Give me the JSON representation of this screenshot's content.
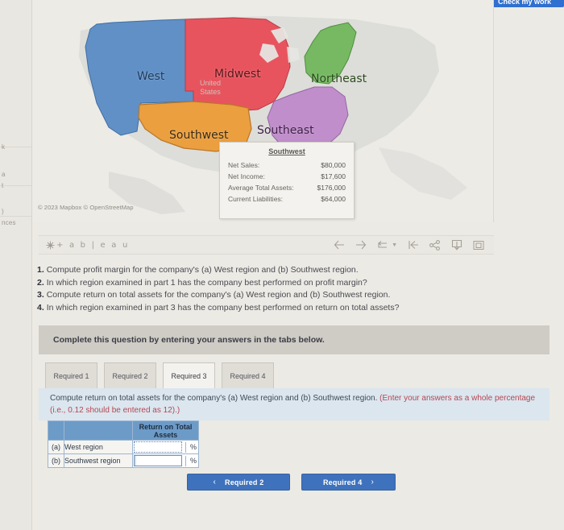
{
  "top_button": {
    "label": "Check my work"
  },
  "left_rail": {
    "fragments": [
      "k",
      "a",
      "t",
      ")",
      "nces"
    ]
  },
  "map": {
    "attribution": "© 2023 Mapbox © OpenStreetMap",
    "watermark": "United\nStates",
    "regions": [
      {
        "name": "West",
        "label": "West",
        "color": "#6090c6"
      },
      {
        "name": "Midwest",
        "label": "Midwest",
        "color": "#e8545e"
      },
      {
        "name": "Northeast",
        "label": "Northeast",
        "color": "#76b962"
      },
      {
        "name": "Southeast",
        "label": "Southeast",
        "color": "#c08ecb"
      },
      {
        "name": "Southwest",
        "label": "Southwest",
        "color": "#eb9f3f"
      }
    ],
    "tooltip": {
      "title": "Southwest",
      "rows": [
        {
          "label": "Net Sales:",
          "value": "$80,000"
        },
        {
          "label": "Net Income:",
          "value": "$17,600"
        },
        {
          "label": "Average Total Assets:",
          "value": "$176,000"
        },
        {
          "label": "Current Liabilities:",
          "value": "$64,000"
        }
      ]
    }
  },
  "tableau": {
    "logo_text": "+ a b | e a u",
    "tools": [
      {
        "name": "back",
        "glyph": "←"
      },
      {
        "name": "forward",
        "glyph": "→"
      },
      {
        "name": "revert",
        "glyph": "↶"
      },
      {
        "name": "reset",
        "glyph": "|←"
      },
      {
        "name": "share",
        "glyph": "share"
      },
      {
        "name": "download",
        "glyph": "↧"
      },
      {
        "name": "fullscreen",
        "glyph": "⧉"
      }
    ]
  },
  "questions": [
    {
      "num": "1.",
      "text": "Compute profit margin for the company's (a) West region and (b) Southwest region."
    },
    {
      "num": "2.",
      "text": "In which region examined in part 1 has the company best performed on profit margin?"
    },
    {
      "num": "3.",
      "text": "Compute return on total assets for the company's (a) West region and (b) Southwest region."
    },
    {
      "num": "4.",
      "text": "In which region examined in part 3 has the company best performed on return on total assets?"
    }
  ],
  "complete_bar": {
    "text": "Complete this question by entering your answers in the tabs below."
  },
  "tabs": [
    {
      "label": "Required 1",
      "active": false
    },
    {
      "label": "Required 2",
      "active": false
    },
    {
      "label": "Required 3",
      "active": true
    },
    {
      "label": "Required 4",
      "active": false
    }
  ],
  "prompt": {
    "main": "Compute return on total assets for the company's (a) West region and (b) Southwest region. ",
    "hint": "(Enter your answers as a whole percentage (i.e., 0.12 should be entered as 12).)"
  },
  "answer_table": {
    "headers": [
      "",
      "",
      "Return on Total Assets"
    ],
    "rows": [
      {
        "mark": "(a)",
        "name": "West region",
        "value": "",
        "unit": "%"
      },
      {
        "mark": "(b)",
        "name": "Southwest region",
        "value": "",
        "unit": "%"
      }
    ]
  },
  "nav": {
    "prev_label": "Required 2",
    "next_label": "Required 4",
    "prev_chevron": "‹",
    "next_chevron": "›"
  },
  "colors": {
    "accent_blue": "#3f72bd",
    "table_header": "#6d9bc8",
    "prompt_bg": "#dbe6ef",
    "hint_red": "#b6474f"
  }
}
